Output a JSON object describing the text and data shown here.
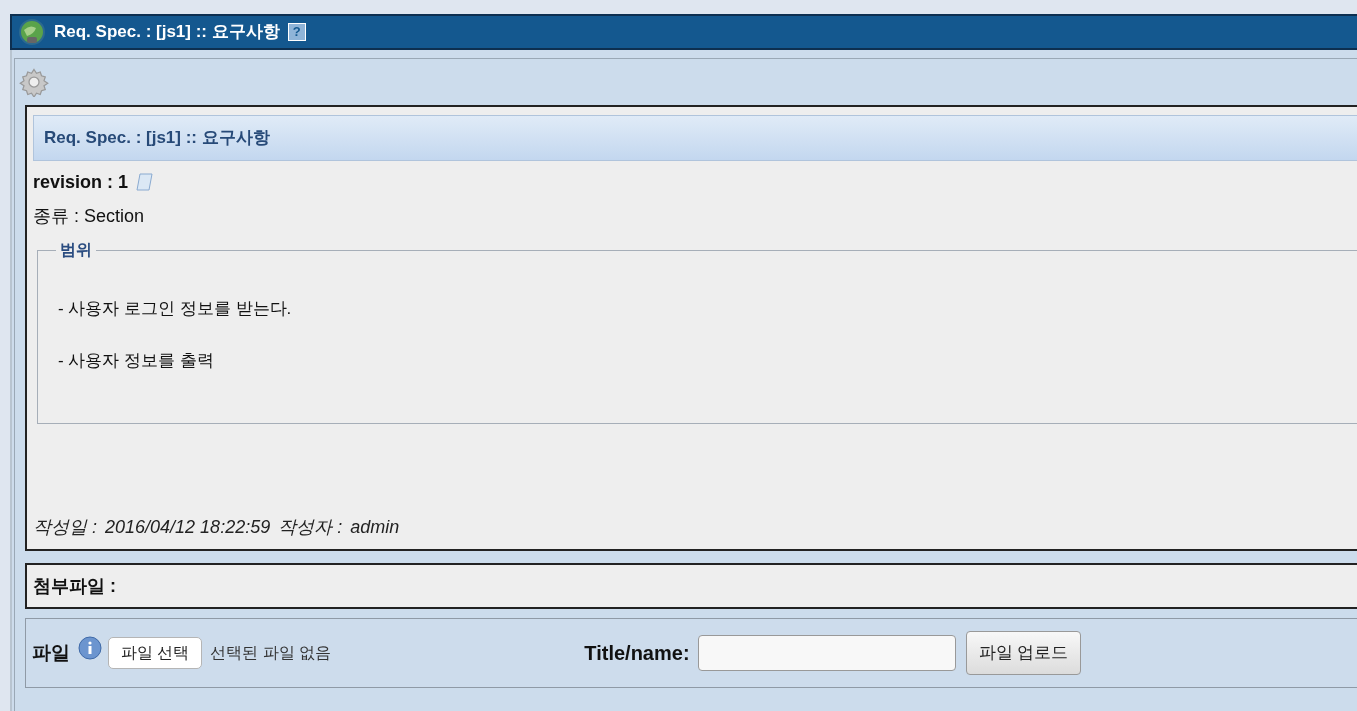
{
  "window": {
    "title": "Req. Spec. : [js1] :: 요구사항",
    "help": "?"
  },
  "spec": {
    "header": "Req. Spec. : [js1] :: 요구사항",
    "revision": "revision : 1",
    "type": "종류 : Section",
    "scope": {
      "legend": "범위",
      "lines": [
        "- 사용자 로그인 정보를 받는다.",
        "- 사용자 정보를 출력"
      ]
    },
    "footer": {
      "created_label": "작성일 :",
      "created": "2016/04/12 18:22:59",
      "author_label": "작성자 :",
      "author": "admin"
    }
  },
  "attachments": {
    "label": "첨부파일 :"
  },
  "upload": {
    "label": "파일",
    "choose_button": "파일 선택",
    "no_file": "선택된 파일 없음",
    "title_label": "Title/name:",
    "upload_button": "파일 업로드"
  }
}
